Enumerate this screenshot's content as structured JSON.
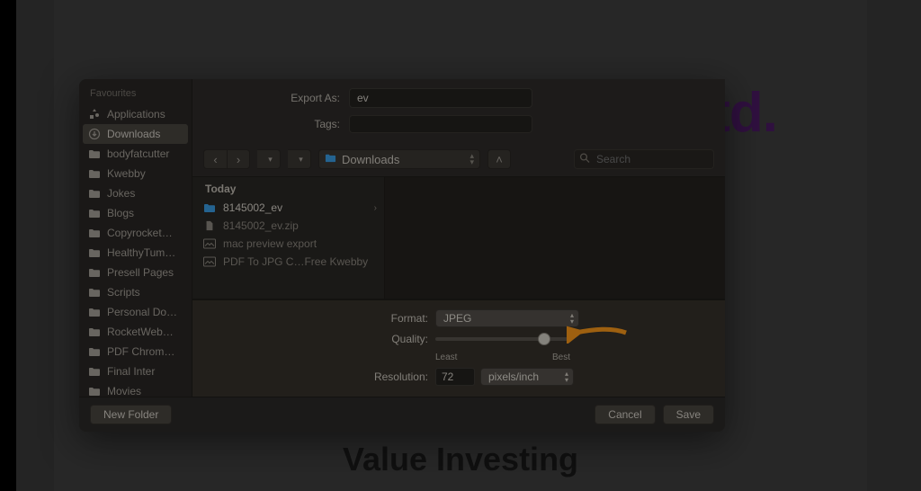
{
  "background": {
    "partial_logo": "_td.",
    "page_title": "Value Investing"
  },
  "dialog": {
    "export_label": "Export As:",
    "export_value": "ev",
    "tags_label": "Tags:",
    "sidebar": {
      "header": "Favourites",
      "items": [
        {
          "label": "Applications",
          "icon": "apps"
        },
        {
          "label": "Downloads",
          "icon": "downloads",
          "selected": true
        },
        {
          "label": "bodyfatcutter",
          "icon": "folder"
        },
        {
          "label": "Kwebby",
          "icon": "folder"
        },
        {
          "label": "Jokes",
          "icon": "folder"
        },
        {
          "label": "Blogs",
          "icon": "folder"
        },
        {
          "label": "Copyrocket…",
          "icon": "folder"
        },
        {
          "label": "HealthyTum…",
          "icon": "folder"
        },
        {
          "label": "Presell Pages",
          "icon": "folder"
        },
        {
          "label": "Scripts",
          "icon": "folder"
        },
        {
          "label": "Personal Do…",
          "icon": "folder"
        },
        {
          "label": "RocketWeb…",
          "icon": "folder"
        },
        {
          "label": "PDF Chrom…",
          "icon": "folder"
        },
        {
          "label": "Final Inter",
          "icon": "folder"
        },
        {
          "label": "Movies",
          "icon": "folder"
        }
      ]
    },
    "location": "Downloads",
    "search_placeholder": "Search",
    "file_group_header": "Today",
    "files": [
      {
        "name": "8145002_ev",
        "icon": "folder-blue",
        "selected": true,
        "disclosure": true
      },
      {
        "name": "8145002_ev.zip",
        "icon": "doc"
      },
      {
        "name": "mac preview export",
        "icon": "image"
      },
      {
        "name": "PDF To JPG C…Free  Kwebby",
        "icon": "image"
      }
    ],
    "options": {
      "format_label": "Format:",
      "format_value": "JPEG",
      "quality_label": "Quality:",
      "quality_least": "Least",
      "quality_best": "Best",
      "quality_pct": 82,
      "resolution_label": "Resolution:",
      "resolution_value": "72",
      "resolution_unit": "pixels/inch"
    },
    "footer": {
      "new_folder": "New Folder",
      "cancel": "Cancel",
      "save": "Save"
    }
  }
}
